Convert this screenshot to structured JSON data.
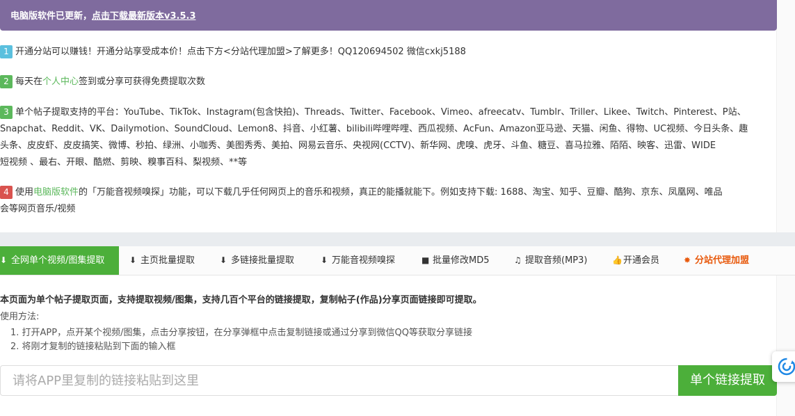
{
  "banner": {
    "text": "电脑版软件已更新，",
    "link": "点击下载最新版本v3.5.3"
  },
  "notes": [
    {
      "num": "1",
      "text": "开通分站可以赚钱！开通分站享受成本价！点击下方<分站代理加盟>了解更多！QQ120694502 微信cxkj5188"
    },
    {
      "num": "2",
      "before": "每天在",
      "link": "个人中心",
      "after": "签到或分享可获得免费提取次数"
    },
    {
      "num": "3",
      "line1": "单个帖子提取支持的平台：YouTube、TikTok、Instagram(包含快拍)、Threads、Twitter、Facebook、Vimeo、afreecatv、Tumblr、Triller、Likee、Twitch、Pinterest、P站、",
      "line2": "Snapchat、Reddit、VK、Dailymotion、SoundCloud、Lemon8、抖音、小红薯、bilibili哔哩哔哩、西瓜视频、AcFun、Amazon亚马逊、天猫、闲鱼、得物、UC视频、今日头条、趣",
      "line3": "头条、皮皮虾、皮皮搞笑、微博、秒拍、绿洲、小咖秀、美图秀秀、美拍、网易云音乐、央视网(CCTV)、新华网、虎嗅、虎牙、斗鱼、糖豆、喜马拉雅、陌陌、映客、迅雷、WIDE",
      "line4": "短视频 、最右、开眼、酷燃、剪映、糗事百科、梨视频、**等"
    },
    {
      "num": "4",
      "before": "使用",
      "link": "电脑版软件",
      "line1_after": "的「万能音视频嗅探」功能，可以下载几乎任何网页上的音乐和视频，真正的能播就能下。例如支持下载: 1688、淘宝、知乎、豆瓣、酷狗、京东、凤凰网、唯品",
      "line2": "会等网页音乐/视频"
    }
  ],
  "tabs": [
    {
      "label": "全网单个视频/图集提取",
      "icon": "download-icon",
      "glyph": "⬇",
      "active": true
    },
    {
      "label": "主页批量提取",
      "icon": "download-icon",
      "glyph": "⬇"
    },
    {
      "label": "多链接批量提取",
      "icon": "download-icon",
      "glyph": "⬇"
    },
    {
      "label": "万能音视频嗅探",
      "icon": "download-icon",
      "glyph": "⬇"
    },
    {
      "label": "批量修改MD5",
      "icon": "video-camera-icon",
      "glyph": "■"
    },
    {
      "label": "提取音频(MP3)",
      "icon": "music-note-icon",
      "glyph": "♫"
    },
    {
      "label": "开通会员",
      "icon": "thumbs-up-icon",
      "glyph": "👍"
    },
    {
      "label": "分站代理加盟",
      "icon": "maple-leaf-icon",
      "glyph": "✸"
    }
  ],
  "description": {
    "title": "本页面为单个帖子提取页面，支持提取视频/图集，支持几百个平台的链接提取，复制帖子(作品)分享页面链接即可提取。",
    "usage_label": "使用方法:",
    "steps": [
      "1. 打开APP，点开某个视频/图集，点击分享按钮，在分享弹框中点击复制链接或通过分享到微信QQ等获取分享链接",
      "2. 将刚才复制的链接粘贴到下面的输入框"
    ]
  },
  "input": {
    "placeholder": "请将APP里复制的链接粘贴到这里",
    "value": ""
  },
  "submit_label": "单个链接提取",
  "colors": {
    "banner": "#7f6b9e",
    "accent_green": "#4caf3a",
    "agent_orange": "#e8590c"
  }
}
